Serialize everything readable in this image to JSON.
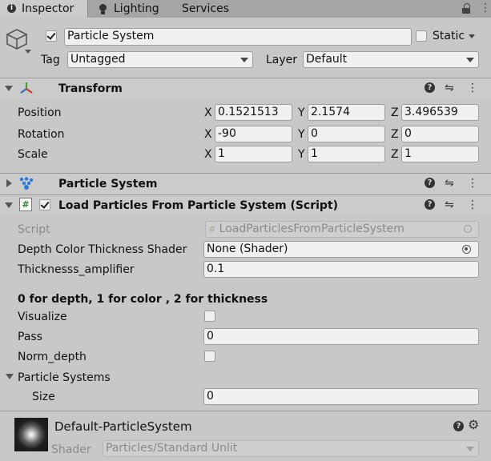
{
  "tabs": [
    {
      "label": "Inspector",
      "icon": "info-icon"
    },
    {
      "label": "Lighting",
      "icon": "lightbulb-icon"
    },
    {
      "label": "Services"
    }
  ],
  "object": {
    "active": true,
    "name": "Particle System",
    "static_label": "Static",
    "static_checked": false,
    "tag_label": "Tag",
    "tag_value": "Untagged",
    "layer_label": "Layer",
    "layer_value": "Default"
  },
  "transform": {
    "title": "Transform",
    "rows": [
      {
        "label": "Position",
        "x": "0.1521513",
        "y": "2.1574",
        "z": "3.496539"
      },
      {
        "label": "Rotation",
        "x": "-90",
        "y": "0",
        "z": "0"
      },
      {
        "label": "Scale",
        "x": "1",
        "y": "1",
        "z": "1"
      }
    ],
    "axis": {
      "x": "X",
      "y": "Y",
      "z": "Z"
    }
  },
  "particle_system": {
    "title": "Particle System"
  },
  "script": {
    "title": "Load Particles From Particle System (Script)",
    "enabled": true,
    "script_label": "Script",
    "script_value": "LoadParticlesFromParticleSystem",
    "shader_label": "Depth Color Thickness Shader",
    "shader_value": "None (Shader)",
    "thickness_label": "Thicknesss_amplifier",
    "thickness_value": "0.1",
    "section_header": "0 for depth, 1 for color , 2 for thickness",
    "visualize_label": "Visualize",
    "visualize_checked": false,
    "pass_label": "Pass",
    "pass_value": "0",
    "norm_label": "Norm_depth",
    "norm_checked": false,
    "particle_systems_label": "Particle Systems",
    "size_label": "Size",
    "size_value": "0"
  },
  "material": {
    "name": "Default-ParticleSystem",
    "shader_label": "Shader",
    "shader_value": "Particles/Standard Unlit"
  }
}
